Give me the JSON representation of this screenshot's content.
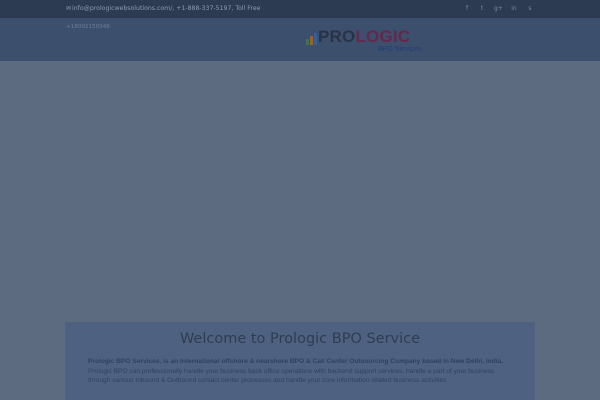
{
  "topbar": {
    "mail_icon": "envelope-icon",
    "contact_text": "info@prologicwebsolutions.com/, +1-888-337-5197, Toll Free",
    "tollfree_number": "+18002150348",
    "social_icons": [
      {
        "name": "facebook-icon",
        "glyph": "f"
      },
      {
        "name": "twitter-icon",
        "glyph": "t"
      },
      {
        "name": "google-plus-icon",
        "glyph": "g+"
      },
      {
        "name": "linkedin-icon",
        "glyph": "in"
      },
      {
        "name": "skype-icon",
        "glyph": "s"
      }
    ]
  },
  "logo": {
    "pro": "PRO",
    "logic": "LOGIC",
    "subtitle": "BPO Services",
    "bar_colors": [
      "#3f7a2e",
      "#b05a1c",
      "#2a63a8"
    ]
  },
  "welcome": {
    "title": "Welcome to Prologic BPO Service",
    "intro_bold": "Prologic BPO Services, is an International offshore & nearshore BPO & Call Center Outsourcing Company based in New Delhi, India.",
    "intro_text": "Prologic BPO can professionally handle your business back office operations with backend support services, handle a part of your business through various Inbound & Outbound contact center processes and handle your core information related business activities"
  },
  "colors": {
    "topbar_bg": "#2c3b52",
    "header_bg": "#3c4f6c",
    "hero_bg": "#5c6b80",
    "welcome_bg": "#4f6180"
  }
}
